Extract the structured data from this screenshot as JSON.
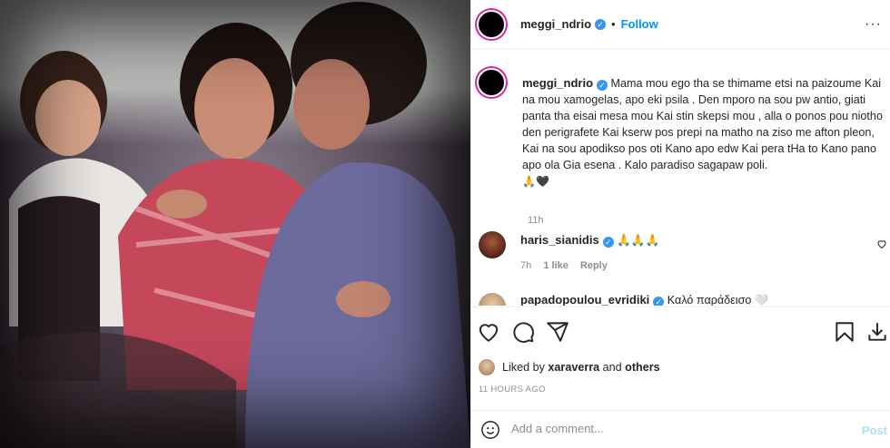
{
  "post": {
    "username": "meggi_ndrio",
    "dot": "•",
    "follow_label": "Follow",
    "more_label": "···",
    "caption_text": "Mama mou ego tha se thimame etsi na paizoume Kai na mou xamogelas, apo eki psila . Den mporo na sou pw antio, giati panta tha eisai mesa mou Kai stin skepsi mou , alla o ponos pou niotho den perigrafete Kai kserw pos prepi na matho na ziso me afton pleon, Kai na sou apodikso pos oti Kano apo edw Kai pera tHa to Kano pano apo ola Gia esena . Kalo paradiso sagapaw poli.",
    "caption_emojis": "🙏🖤",
    "caption_time": "11h"
  },
  "comments": [
    {
      "username": "haris_sianidis",
      "text": "🙏🙏🙏",
      "time": "7h",
      "likes": "1 like",
      "reply_label": "Reply"
    },
    {
      "username": "papadopoulou_evridiki",
      "text": "Καλό παράδεισο 🤍"
    }
  ],
  "likes": {
    "prefix": "Liked by",
    "user": "xaraverra",
    "and": "and",
    "others": "others"
  },
  "timestamp": "11 HOURS AGO",
  "add_comment": {
    "placeholder": "Add a comment...",
    "post_label": "Post"
  },
  "colors": {
    "accent": "#0095f6",
    "verified": "#3897f0",
    "muted": "#8e8e8e",
    "post_disabled": "#b2dffc"
  }
}
